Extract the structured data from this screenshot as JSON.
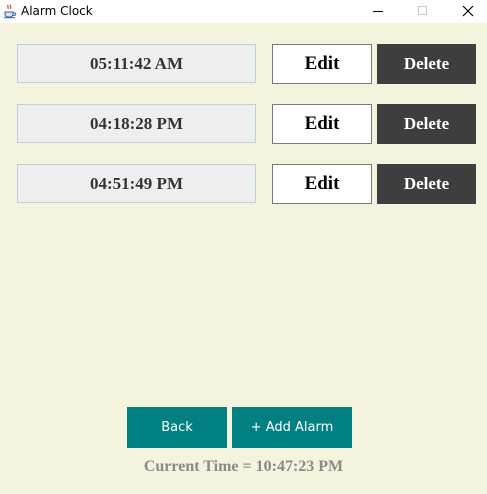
{
  "window": {
    "title": "Alarm Clock"
  },
  "alarms": [
    {
      "time": "05:11:42 AM",
      "edit_label": "Edit",
      "delete_label": "Delete"
    },
    {
      "time": "04:18:28 PM",
      "edit_label": "Edit",
      "delete_label": "Delete"
    },
    {
      "time": "04:51:49 PM",
      "edit_label": "Edit",
      "delete_label": "Delete"
    }
  ],
  "footer": {
    "back_label": "Back",
    "add_label": "+ Add Alarm",
    "current_time": "Current Time = 10:47:23 PM"
  },
  "colors": {
    "background": "#f4f4de",
    "teal": "#008080",
    "delete_bg": "#3e3e3e",
    "time_field_bg": "#eeeeee"
  },
  "icons": {
    "app": "java-coffee-cup-icon",
    "minimize": "minimize-icon",
    "maximize": "maximize-icon",
    "close": "close-icon"
  }
}
